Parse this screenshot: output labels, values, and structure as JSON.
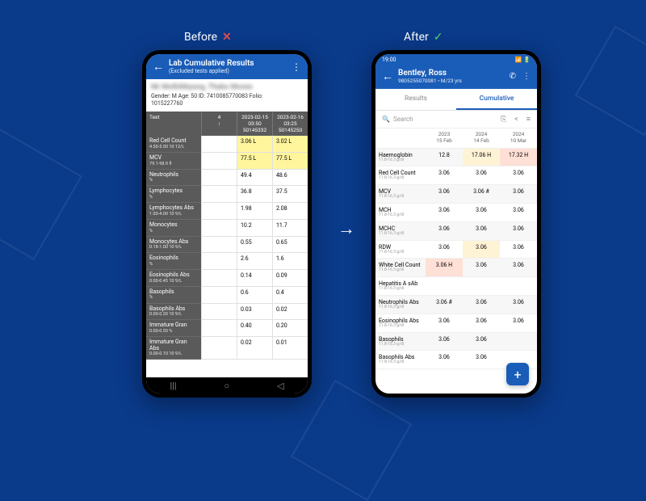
{
  "labels": {
    "before": "Before",
    "after": "After"
  },
  "before": {
    "header": {
      "title": "Lab Cumulative Results",
      "subtitle": "(Excluded tests applied)"
    },
    "meta": {
      "name": "Mr Mothibkyung, Thabo Moses",
      "line2": "Gender: M   Age: 50   ID: 7410085770083   Folio:",
      "folio": "1015227760"
    },
    "columns": [
      {
        "top": "4",
        "bottom": "↑"
      },
      {
        "top": "2023-02-15",
        "mid": "03:50",
        "bottom": "50145332"
      },
      {
        "top": "2023-02-16",
        "mid": "03:25",
        "bottom": "50145250"
      }
    ],
    "col1_label": "Test",
    "rows": [
      {
        "name": "Red Cell Count",
        "sub": "4.50-5.50   10 12/L",
        "v1": "3.06 L",
        "v2": "3.02 L",
        "hl": true
      },
      {
        "name": "MCV",
        "sub": "79.1-98.9   fl",
        "v1": "77.5 L",
        "v2": "77.5 L",
        "hl": true
      },
      {
        "name": "Neutrophils",
        "sub": "%",
        "v1": "49.4",
        "v2": "48.6"
      },
      {
        "name": "Lymphocytes",
        "sub": "%",
        "v1": "36.8",
        "v2": "37.5"
      },
      {
        "name": "Lymphocytes Abs",
        "sub": "1.00-4.00   10 9/L",
        "v1": "1.98",
        "v2": "2.08"
      },
      {
        "name": "Monocytes",
        "sub": "%",
        "v1": "10.2",
        "v2": "11.7"
      },
      {
        "name": "Monocytes Abs",
        "sub": "0.18-1.00   10 9/L",
        "v1": "0.55",
        "v2": "0.65"
      },
      {
        "name": "Eosinophils",
        "sub": "%",
        "v1": "2.6",
        "v2": "1.6"
      },
      {
        "name": "Eosinophils Abs",
        "sub": "0.00-0.45   10 9/L",
        "v1": "0.14",
        "v2": "0.09"
      },
      {
        "name": "Basophils",
        "sub": "%",
        "v1": "0.6",
        "v2": "0.4"
      },
      {
        "name": "Basophils Abs",
        "sub": "0.00-0.20   10 9/L",
        "v1": "0.03",
        "v2": "0.02"
      },
      {
        "name": "Immature Gran",
        "sub": "0.00-0.55   %",
        "v1": "0.40",
        "v2": "0.20"
      },
      {
        "name": "Immature Gran Abs",
        "sub": "0.00-0.10   10 9/L",
        "v1": "0.02",
        "v2": "0.01"
      }
    ]
  },
  "after": {
    "statusbar": {
      "time": "19:00",
      "icons": "📶🔋"
    },
    "header": {
      "title": "Bentley, Ross",
      "subtitle": "9805255070081 • M/23 yrs"
    },
    "tabs": {
      "results": "Results",
      "cumulative": "Cumulative"
    },
    "search_placeholder": "Search",
    "columns": [
      {
        "y": "2023",
        "d": "15 Feb"
      },
      {
        "y": "2024",
        "d": "14 Feb"
      },
      {
        "y": "2024",
        "d": "10 Mar"
      }
    ],
    "rows": [
      {
        "name": "Haemoglobin",
        "sub": "11.8-16.3 g/dl",
        "v": [
          "12.8",
          "17.06 H",
          "17.32 H"
        ],
        "flags": [
          "",
          "warn",
          "err"
        ],
        "alt": true
      },
      {
        "name": "Red Cell Count",
        "sub": "11.8-16.3 g/dl",
        "v": [
          "3.06",
          "3.06",
          "3.06"
        ],
        "flags": [
          "",
          "",
          ""
        ]
      },
      {
        "name": "MCV",
        "sub": "11.8-16.3 g/dl",
        "v": [
          "3.06",
          "3.06 #",
          "3.06"
        ],
        "flags": [
          "",
          "",
          ""
        ],
        "alt": true
      },
      {
        "name": "MCH",
        "sub": "11.8-16.3 g/dl",
        "v": [
          "3.06",
          "3.06",
          "3.06"
        ],
        "flags": [
          "",
          "",
          ""
        ]
      },
      {
        "name": "MCHC",
        "sub": "11.8-16.3 g/dl",
        "v": [
          "3.06",
          "3.06",
          "3.06"
        ],
        "flags": [
          "",
          "",
          ""
        ],
        "alt": true
      },
      {
        "name": "RDW",
        "sub": "11.8-16.3 g/dl",
        "v": [
          "3.06",
          "3.06",
          "3.06"
        ],
        "flags": [
          "",
          "warn",
          ""
        ]
      },
      {
        "name": "White Cell Count",
        "sub": "11.8-16.3 g/dl",
        "v": [
          "3.06 H",
          "3.06",
          "3.06"
        ],
        "flags": [
          "err",
          "",
          ""
        ],
        "alt": true
      },
      {
        "name": "Hepatitis A sAb",
        "sub": "11.8-16.3 g/dl",
        "v": [
          "",
          "",
          ""
        ],
        "flags": [
          "",
          "",
          ""
        ]
      },
      {
        "name": "Neutrophils Abs",
        "sub": "11.8-16.3 g/dl",
        "v": [
          "3.06 #",
          "3.06",
          "3.06"
        ],
        "flags": [
          "",
          "",
          ""
        ],
        "alt": true
      },
      {
        "name": "Eosinophils Abs",
        "sub": "11.8-16.3 g/dl",
        "v": [
          "3.06",
          "3.06",
          "3.06"
        ],
        "flags": [
          "",
          "",
          ""
        ]
      },
      {
        "name": "Basophils",
        "sub": "11.8-16.3 g/dl",
        "v": [
          "3.06",
          "3.06",
          ""
        ],
        "flags": [
          "",
          "",
          ""
        ],
        "alt": true
      },
      {
        "name": "Basophils Abs",
        "sub": "11.8-16.3 g/dl",
        "v": [
          "3.06",
          "3.06",
          ""
        ],
        "flags": [
          "",
          "",
          ""
        ]
      }
    ]
  }
}
